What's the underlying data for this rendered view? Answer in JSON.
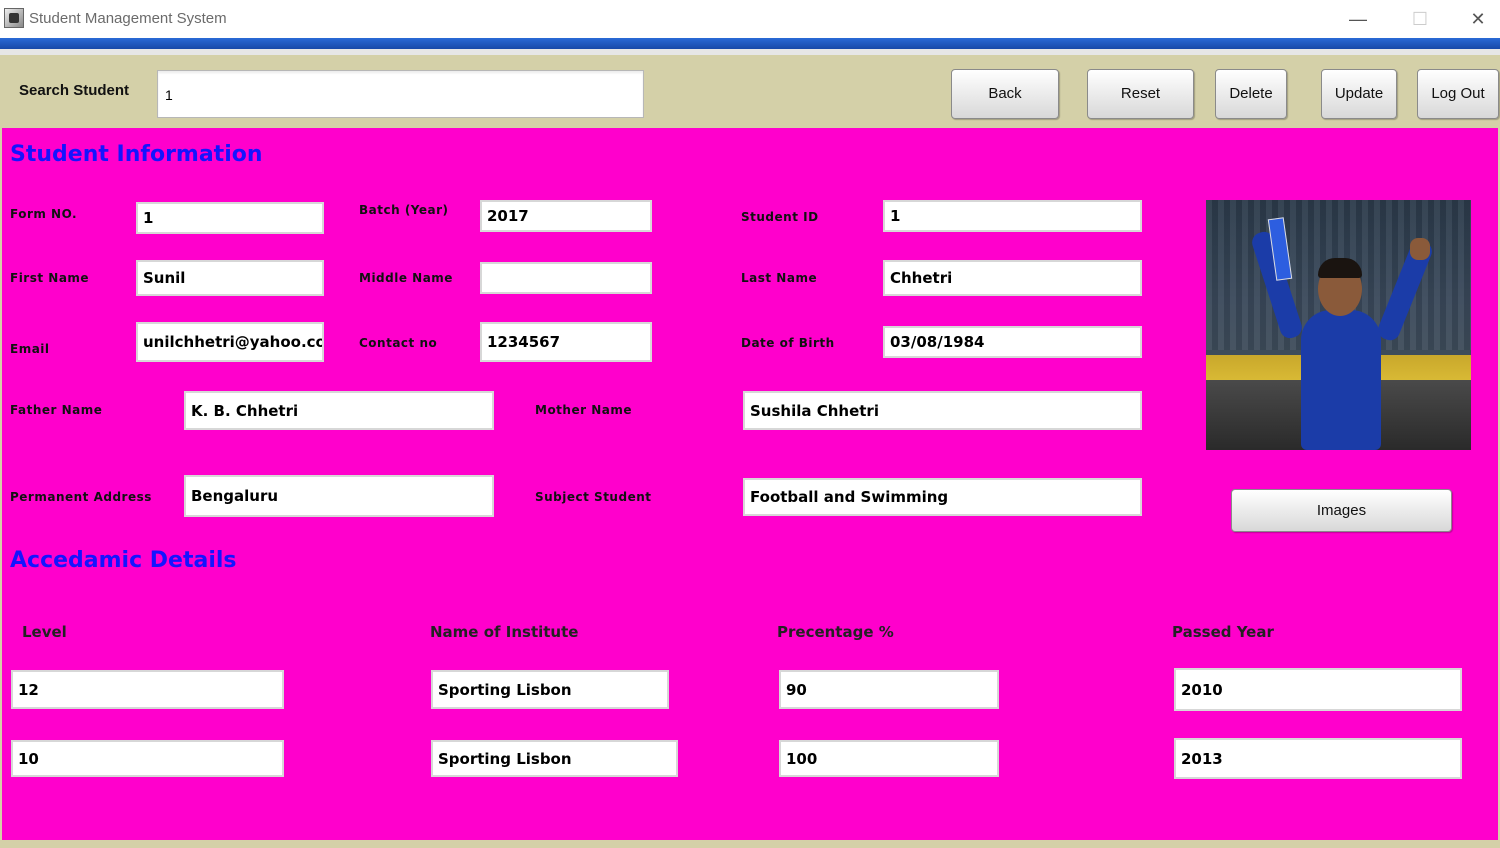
{
  "window": {
    "title": "Student Management System",
    "minimize": "—",
    "maximize": "☐",
    "close": "✕"
  },
  "toolbar": {
    "search_label": "Search Student",
    "search_value": "1",
    "back": "Back",
    "reset": "Reset",
    "delete": "Delete",
    "update": "Update",
    "logout": "Log Out"
  },
  "student_info": {
    "title": "Student Information",
    "form_no": {
      "label": "Form NO.",
      "value": "1"
    },
    "batch": {
      "label": "Batch (Year)",
      "value": "2017"
    },
    "student_id": {
      "label": "Student ID",
      "value": "1"
    },
    "first_name": {
      "label": "First Name",
      "value": "Sunil"
    },
    "middle_name": {
      "label": "Middle Name",
      "value": ""
    },
    "last_name": {
      "label": "Last Name",
      "value": "Chhetri"
    },
    "email": {
      "label": "Email",
      "value": "unilchhetri@yahoo.com"
    },
    "contact": {
      "label": "Contact no",
      "value": "1234567"
    },
    "dob": {
      "label": "Date of Birth",
      "value": "03/08/1984"
    },
    "father_name": {
      "label": "Father Name",
      "value": "K. B. Chhetri"
    },
    "mother_name": {
      "label": "Mother Name",
      "value": "Sushila Chhetri"
    },
    "address": {
      "label": "Permanent  Address",
      "value": "Bengaluru"
    },
    "subject": {
      "label": "Subject Student",
      "value": "Football and Swimming"
    },
    "images_button": "Images"
  },
  "academic": {
    "title": "Accedamic Details",
    "headers": {
      "level": "Level",
      "institute": "Name of Institute",
      "percentage": "Precentage %",
      "year": "Passed Year"
    },
    "rows": [
      {
        "level": "12",
        "institute": "Sporting Lisbon",
        "percentage": "90",
        "year": "2010"
      },
      {
        "level": "10",
        "institute": "Sporting Lisbon",
        "percentage": "100",
        "year": "2013"
      }
    ]
  },
  "colors": {
    "panel_bg": "#ff00cc",
    "toolbar_bg": "#d4d0a8",
    "section_title": "#1414ff"
  }
}
